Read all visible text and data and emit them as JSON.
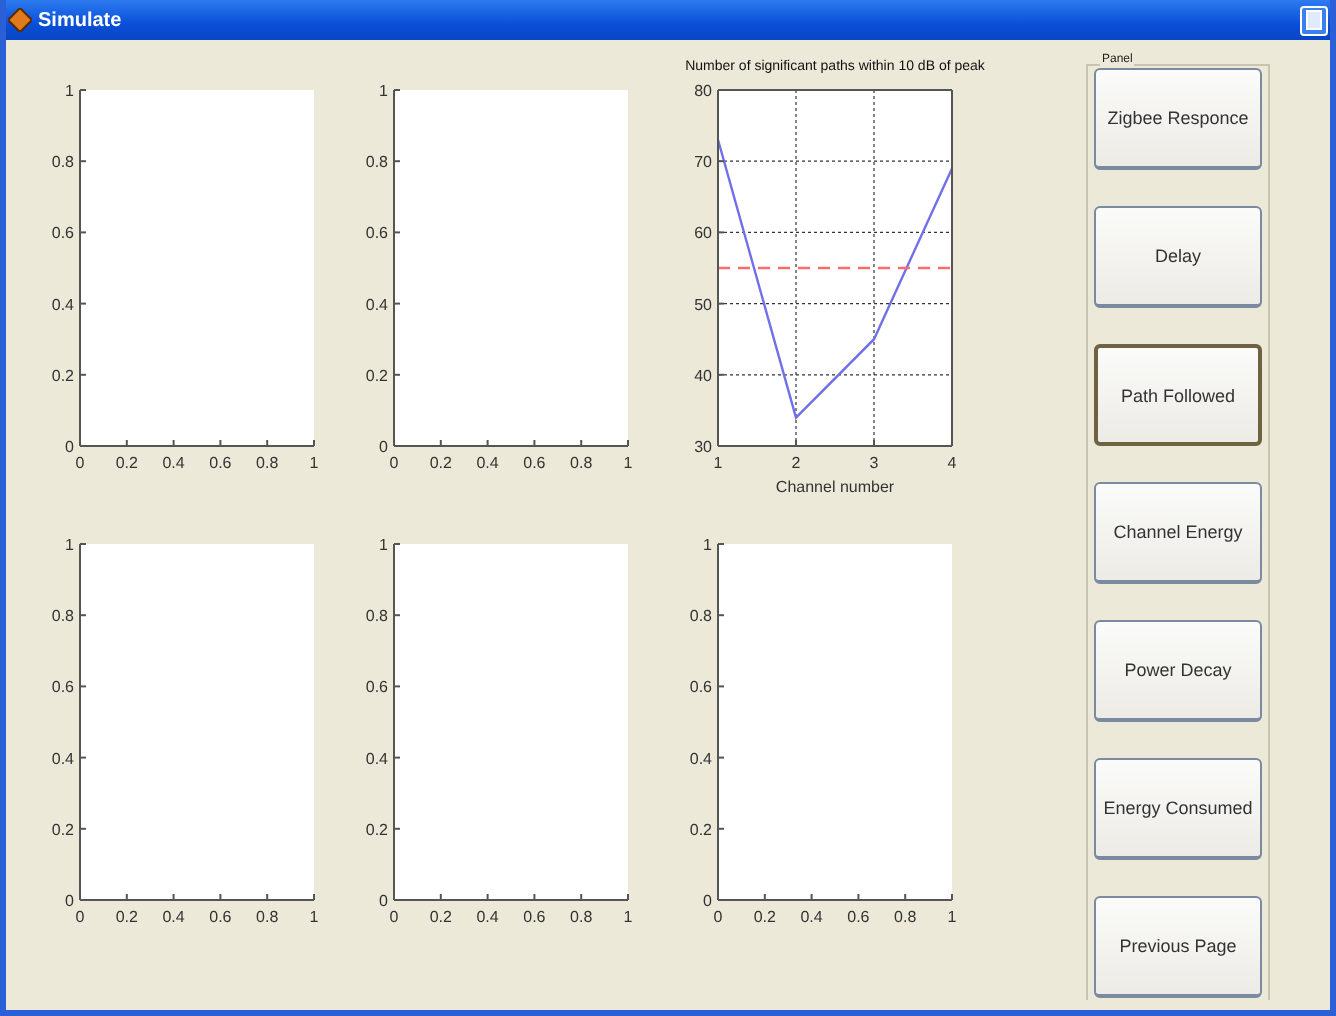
{
  "window": {
    "title": "Simulate"
  },
  "charts": [
    {
      "chart_data": {
        "type": "line",
        "xlim": [
          0,
          1
        ],
        "ylim": [
          0,
          1
        ],
        "xticks": [
          0,
          0.2,
          0.4,
          0.6,
          0.8,
          1
        ],
        "yticks": [
          0,
          0.2,
          0.4,
          0.6,
          0.8,
          1
        ]
      }
    },
    {
      "chart_data": {
        "type": "line",
        "xlim": [
          0,
          1
        ],
        "ylim": [
          0,
          1
        ],
        "xticks": [
          0,
          0.2,
          0.4,
          0.6,
          0.8,
          1
        ],
        "yticks": [
          0,
          0.2,
          0.4,
          0.6,
          0.8,
          1
        ]
      }
    },
    {
      "chart_data": {
        "type": "line",
        "title": "Number of significant paths within 10 dB of peak",
        "xlabel": "Channel number",
        "x": [
          1,
          2,
          3,
          4
        ],
        "grid": true,
        "series": [
          {
            "color": "#7070e8",
            "line_style": "solid",
            "values": [
              73,
              34,
              45,
              69
            ]
          },
          {
            "color": "#ff6b6b",
            "line_style": "dashed",
            "values": [
              55,
              55,
              55,
              55
            ]
          }
        ],
        "xlim": [
          1,
          4
        ],
        "ylim": [
          30,
          80
        ],
        "xticks": [
          1,
          2,
          3,
          4
        ],
        "yticks": [
          30,
          40,
          50,
          60,
          70,
          80
        ]
      }
    },
    {
      "chart_data": {
        "type": "line",
        "xlim": [
          0,
          1
        ],
        "ylim": [
          0,
          1
        ],
        "xticks": [
          0,
          0.2,
          0.4,
          0.6,
          0.8,
          1
        ],
        "yticks": [
          0,
          0.2,
          0.4,
          0.6,
          0.8,
          1
        ]
      }
    },
    {
      "chart_data": {
        "type": "line",
        "xlim": [
          0,
          1
        ],
        "ylim": [
          0,
          1
        ],
        "xticks": [
          0,
          0.2,
          0.4,
          0.6,
          0.8,
          1
        ],
        "yticks": [
          0,
          0.2,
          0.4,
          0.6,
          0.8,
          1
        ]
      }
    },
    {
      "chart_data": {
        "type": "line",
        "xlim": [
          0,
          1
        ],
        "ylim": [
          0,
          1
        ],
        "xticks": [
          0,
          0.2,
          0.4,
          0.6,
          0.8,
          1
        ],
        "yticks": [
          0,
          0.2,
          0.4,
          0.6,
          0.8,
          1
        ]
      }
    }
  ],
  "panel": {
    "title": "Panel",
    "buttons": [
      {
        "label": "Zigbee Responce",
        "selected": false
      },
      {
        "label": "Delay",
        "selected": false
      },
      {
        "label": "Path Followed",
        "selected": true
      },
      {
        "label": "Channel Energy",
        "selected": false
      },
      {
        "label": "Power Decay",
        "selected": false
      },
      {
        "label": "Energy Consumed",
        "selected": false
      },
      {
        "label": "Previous Page",
        "selected": false
      }
    ]
  }
}
